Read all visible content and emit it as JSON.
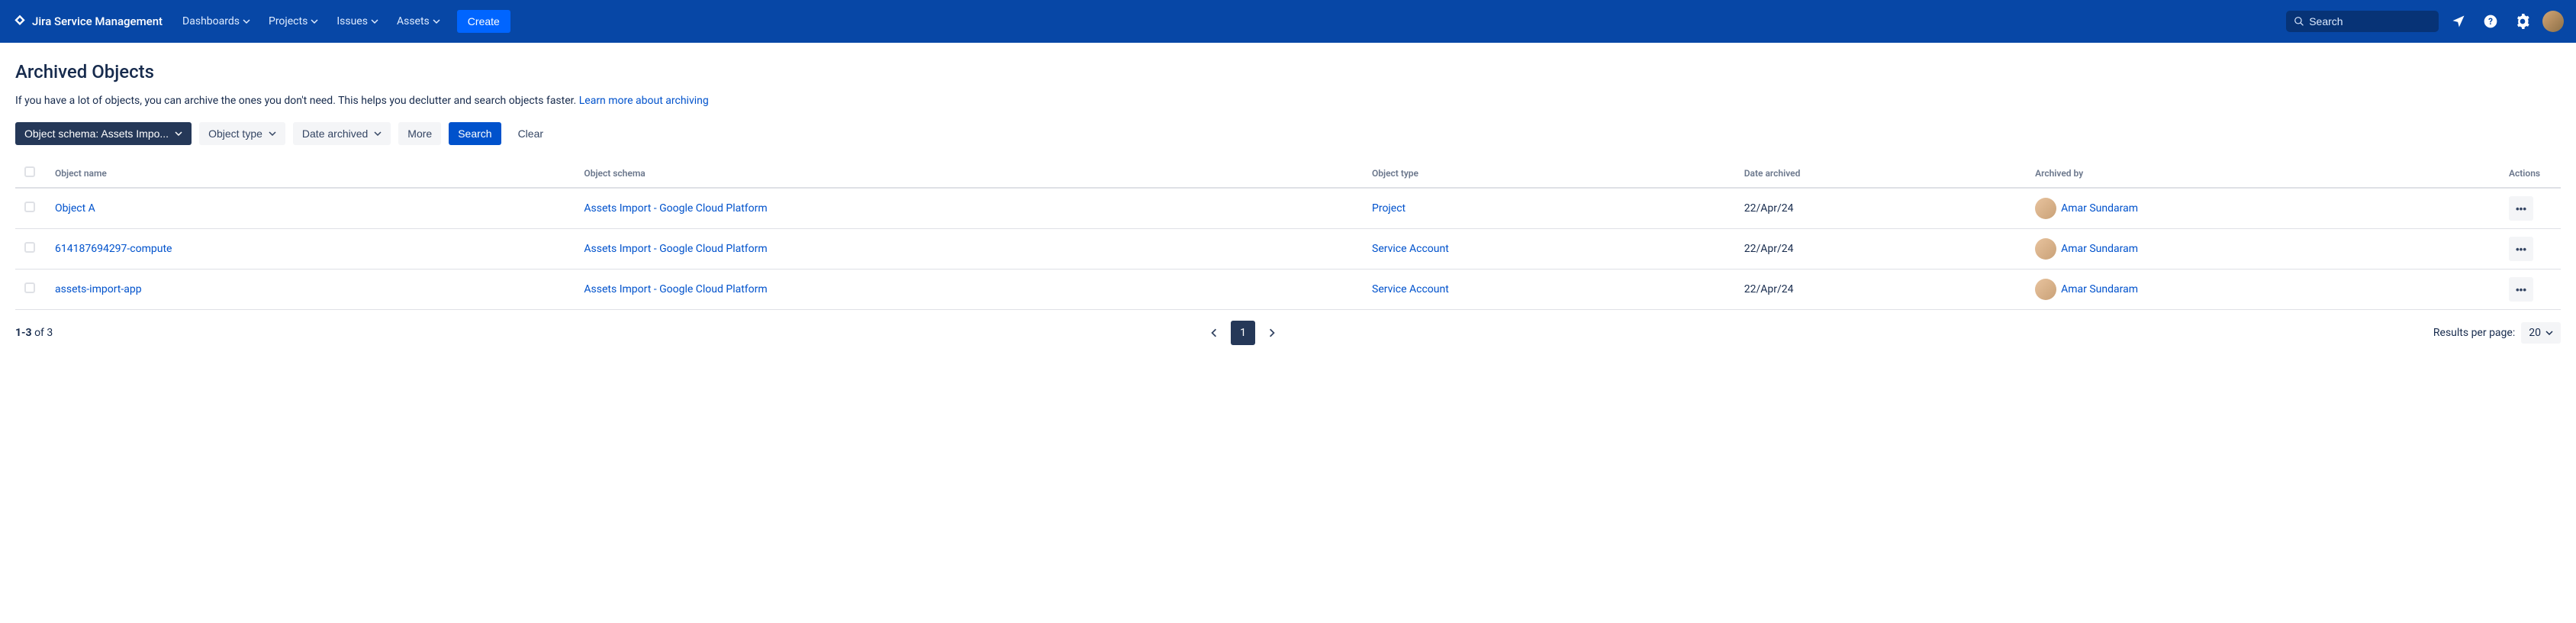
{
  "nav": {
    "product": "Jira Service Management",
    "items": [
      "Dashboards",
      "Projects",
      "Issues",
      "Assets"
    ],
    "create": "Create",
    "search_placeholder": "Search"
  },
  "page": {
    "title": "Archived Objects",
    "description": "If you have a lot of objects, you can archive the ones you don't need. This helps you declutter and search objects faster. ",
    "learn_more": "Learn more about archiving"
  },
  "filters": {
    "schema": "Object schema: Assets Impo...",
    "type": "Object type",
    "date": "Date archived",
    "more": "More",
    "search": "Search",
    "clear": "Clear"
  },
  "table": {
    "headers": {
      "name": "Object name",
      "schema": "Object schema",
      "type": "Object type",
      "date": "Date archived",
      "by": "Archived by",
      "actions": "Actions"
    },
    "rows": [
      {
        "name": "Object A",
        "schema": "Assets Import - Google Cloud Platform",
        "type": "Project",
        "date": "22/Apr/24",
        "by": "Amar Sundaram"
      },
      {
        "name": "614187694297-compute",
        "schema": "Assets Import - Google Cloud Platform",
        "type": "Service Account",
        "date": "22/Apr/24",
        "by": "Amar Sundaram"
      },
      {
        "name": "assets-import-app",
        "schema": "Assets Import - Google Cloud Platform",
        "type": "Service Account",
        "date": "22/Apr/24",
        "by": "Amar Sundaram"
      }
    ]
  },
  "pagination": {
    "range": "1-3",
    "of_label": " of ",
    "total": "3",
    "current": "1",
    "results_label": "Results per page:",
    "per_page": "20"
  }
}
